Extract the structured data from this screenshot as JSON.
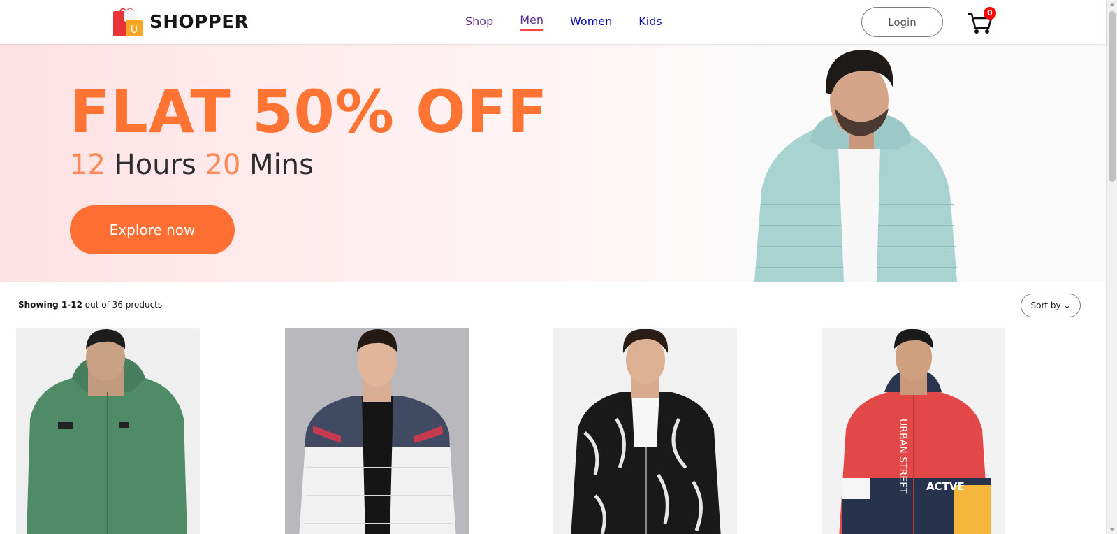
{
  "brand": {
    "name": "SHOPPER",
    "logo_icon": "shopping-bag-icon"
  },
  "nav": {
    "items": [
      {
        "label": "Shop"
      },
      {
        "label": "Men",
        "active": true
      },
      {
        "label": "Women"
      },
      {
        "label": "Kids"
      }
    ]
  },
  "header": {
    "login_label": "Login",
    "cart_icon": "cart-icon",
    "cart_count": "0"
  },
  "hero": {
    "title": "FLAT 50% OFF",
    "timer_hours": "12",
    "hours_label": "Hours",
    "timer_mins": "20",
    "mins_label": "Mins",
    "cta_label": "Explore now"
  },
  "shop": {
    "showing_range": "Showing 1-12",
    "showing_total": "out of 36 products",
    "sort_label": "Sort by"
  },
  "colors": {
    "accent": "#ff7433",
    "nav_link": "#0b0bb5",
    "badge": "#ff0000"
  }
}
